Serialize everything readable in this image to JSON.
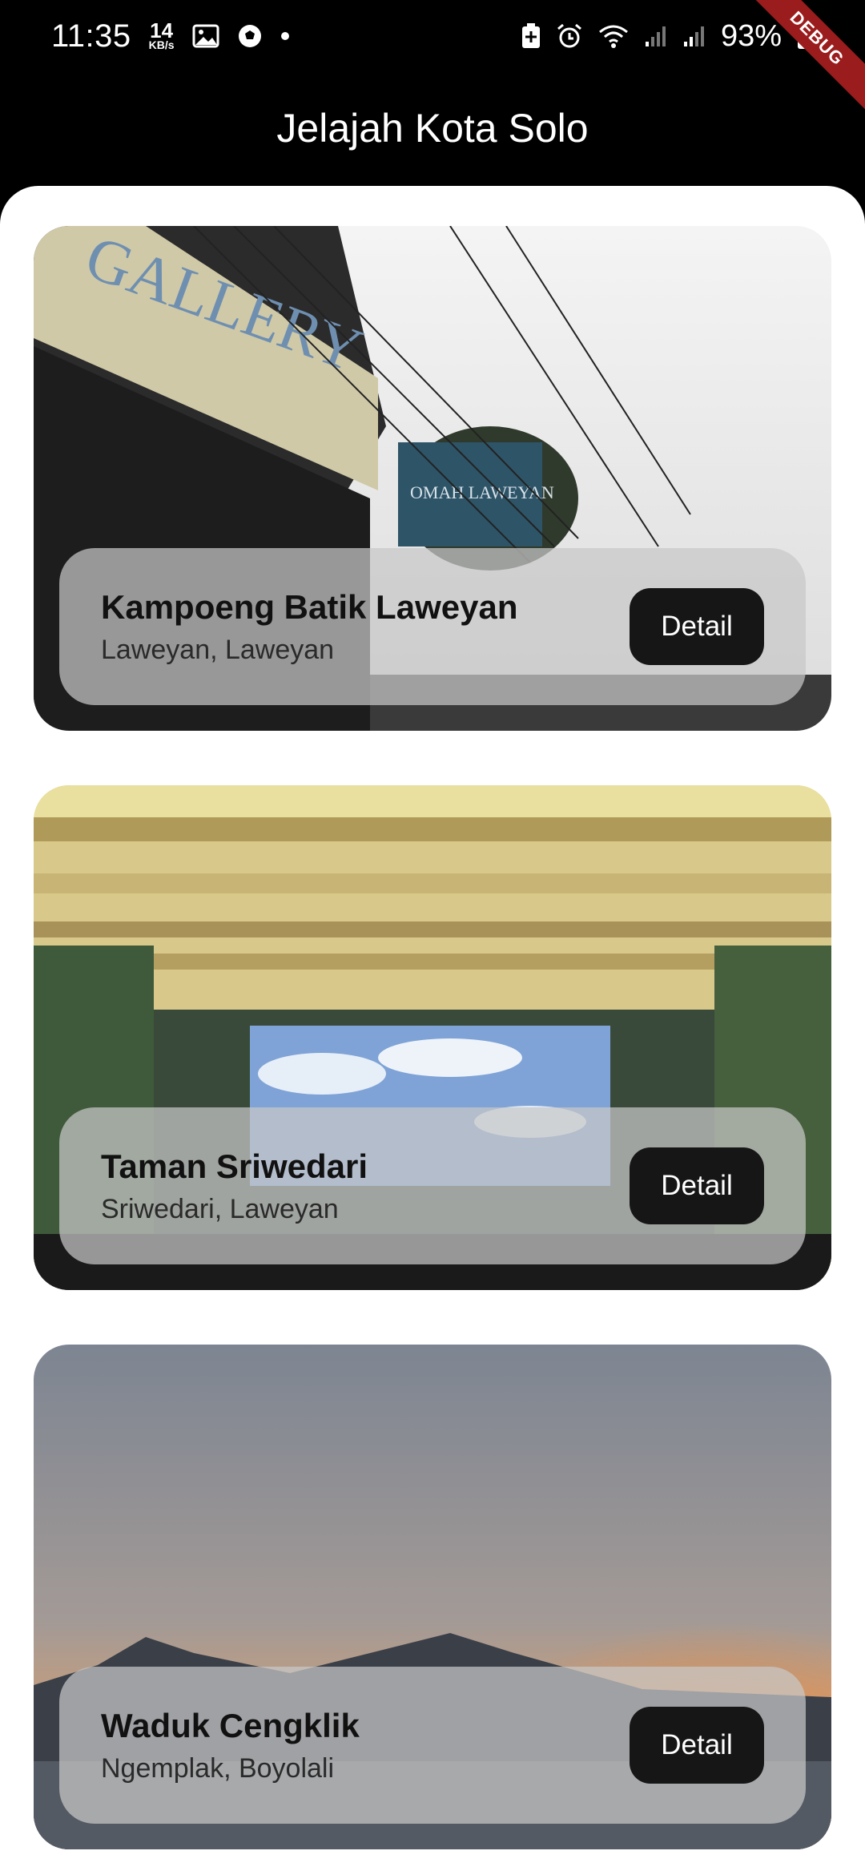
{
  "status_bar": {
    "time": "11:35",
    "net_speed_value": "14",
    "net_speed_unit": "KB/s",
    "battery": "93%"
  },
  "debug_banner": "DEBUG",
  "app_bar": {
    "title": "Jelajah Kota Solo"
  },
  "places": [
    {
      "name": "Kampoeng Batik Laweyan",
      "location": "Laweyan, Laweyan",
      "button_label": "Detail"
    },
    {
      "name": "Taman Sriwedari",
      "location": "Sriwedari, Laweyan",
      "button_label": "Detail"
    },
    {
      "name": "Waduk Cengklik",
      "location": "Ngemplak, Boyolali",
      "button_label": "Detail"
    }
  ],
  "photo_sign_text": {
    "gallery": "GALLERY",
    "omah": "OMAH LAWEYAN"
  }
}
